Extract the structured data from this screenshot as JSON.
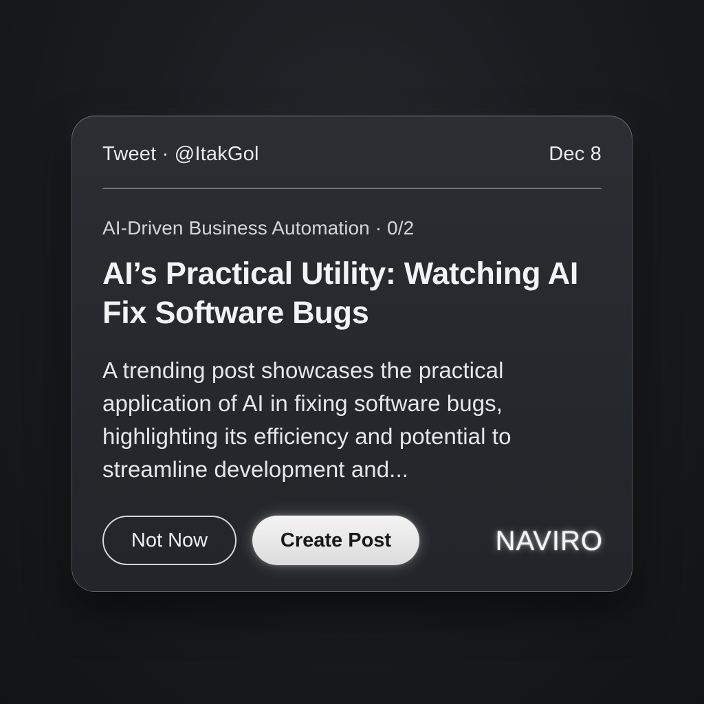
{
  "card": {
    "source_label": "Tweet · @ItakGol",
    "date": "Dec 8",
    "topic": "AI-Driven Business Automation · 0/2",
    "headline": "AI’s Practical Utility: Watching AI Fix Software Bugs",
    "summary": "A trending post showcases the practical application of AI in fixing software bugs, highlighting its efficiency and potential to streamline development and..."
  },
  "actions": {
    "not_now_label": "Not Now",
    "create_post_label": "Create Post"
  },
  "brand": {
    "name": "NAVIRO"
  },
  "colors": {
    "background": "#16181b",
    "card": "#282b2f",
    "primary_button": "#e8e8e8",
    "text": "#f2f3f4"
  }
}
